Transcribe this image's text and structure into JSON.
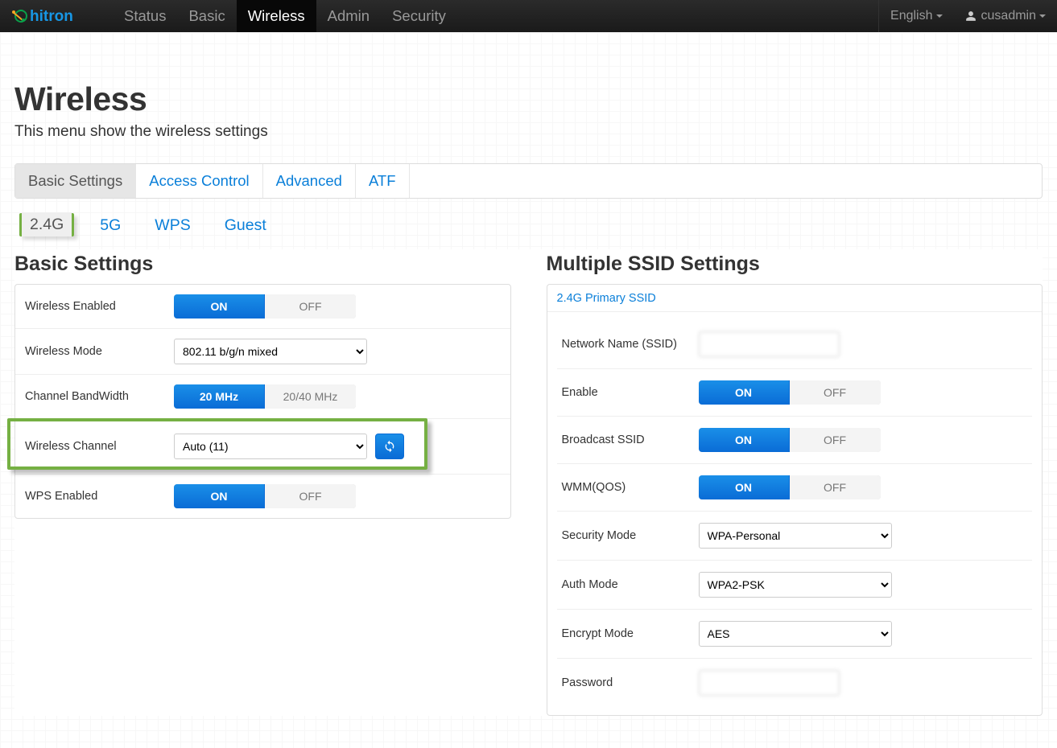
{
  "brand": "hitron",
  "nav": {
    "items": [
      {
        "label": "Status",
        "active": false
      },
      {
        "label": "Basic",
        "active": false
      },
      {
        "label": "Wireless",
        "active": true
      },
      {
        "label": "Admin",
        "active": false
      },
      {
        "label": "Security",
        "active": false
      }
    ],
    "language": "English",
    "user": "cusadmin"
  },
  "page": {
    "title": "Wireless",
    "subtitle": "This menu show the wireless settings"
  },
  "tabs": [
    {
      "label": "Basic Settings",
      "active": true
    },
    {
      "label": "Access Control",
      "active": false
    },
    {
      "label": "Advanced",
      "active": false
    },
    {
      "label": "ATF",
      "active": false
    }
  ],
  "subTabs": [
    {
      "label": "2.4G",
      "active": true,
      "highlight": true
    },
    {
      "label": "5G",
      "active": false
    },
    {
      "label": "WPS",
      "active": false
    },
    {
      "label": "Guest",
      "active": false
    }
  ],
  "basicSettings": {
    "heading": "Basic Settings",
    "wirelessEnabled": {
      "label": "Wireless Enabled",
      "on": "ON",
      "off": "OFF",
      "value": "ON"
    },
    "wirelessMode": {
      "label": "Wireless Mode",
      "value": "802.11 b/g/n mixed"
    },
    "channelBandwidth": {
      "label": "Channel BandWidth",
      "opt1": "20 MHz",
      "opt2": "20/40 MHz",
      "value": "20 MHz"
    },
    "wirelessChannel": {
      "label": "Wireless Channel",
      "value": "Auto (11)",
      "highlight": true
    },
    "wpsEnabled": {
      "label": "WPS Enabled",
      "on": "ON",
      "off": "OFF",
      "value": "ON"
    }
  },
  "ssidSettings": {
    "heading": "Multiple SSID Settings",
    "tab": "2.4G Primary SSID",
    "networkName": {
      "label": "Network Name (SSID)",
      "value": ""
    },
    "enable": {
      "label": "Enable",
      "on": "ON",
      "off": "OFF",
      "value": "ON"
    },
    "broadcast": {
      "label": "Broadcast SSID",
      "on": "ON",
      "off": "OFF",
      "value": "ON"
    },
    "wmm": {
      "label": "WMM(QOS)",
      "on": "ON",
      "off": "OFF",
      "value": "ON"
    },
    "securityMode": {
      "label": "Security Mode",
      "value": "WPA-Personal"
    },
    "authMode": {
      "label": "Auth Mode",
      "value": "WPA2-PSK"
    },
    "encryptMode": {
      "label": "Encrypt Mode",
      "value": "AES"
    },
    "password": {
      "label": "Password",
      "value": ""
    }
  }
}
